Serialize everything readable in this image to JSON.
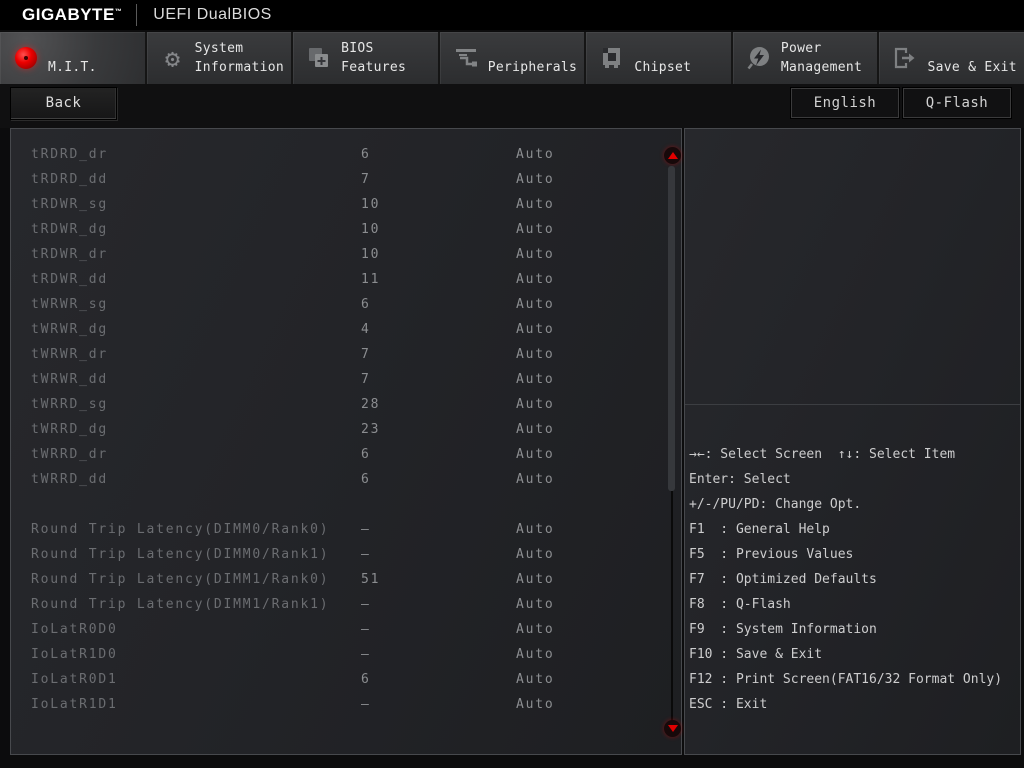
{
  "header": {
    "logo": "GIGABYTE",
    "logo_tm": "™",
    "title": "UEFI DualBIOS"
  },
  "tabs": [
    {
      "label": "M.I.T.",
      "icon": "mit-red-dot",
      "active": true
    },
    {
      "label": "System Information",
      "icon": "gear",
      "active": false
    },
    {
      "label": "BIOS Features",
      "icon": "bios-chip-plus",
      "active": false
    },
    {
      "label": "Peripherals",
      "icon": "peripheral-plug",
      "active": false
    },
    {
      "label": "Chipset",
      "icon": "chipset",
      "active": false
    },
    {
      "label": "Power Management",
      "icon": "power-bolt",
      "active": false
    },
    {
      "label": "Save & Exit",
      "icon": "exit-door",
      "active": false
    }
  ],
  "toolbar": {
    "back": "Back",
    "language": "English",
    "qflash": "Q-Flash"
  },
  "settings": {
    "rows": [
      {
        "name": "tRDRD_dr",
        "value": "6",
        "mode": "Auto"
      },
      {
        "name": "tRDRD_dd",
        "value": "7",
        "mode": "Auto"
      },
      {
        "name": "tRDWR_sg",
        "value": "10",
        "mode": "Auto"
      },
      {
        "name": "tRDWR_dg",
        "value": "10",
        "mode": "Auto"
      },
      {
        "name": "tRDWR_dr",
        "value": "10",
        "mode": "Auto"
      },
      {
        "name": "tRDWR_dd",
        "value": "11",
        "mode": "Auto"
      },
      {
        "name": "tWRWR_sg",
        "value": "6",
        "mode": "Auto"
      },
      {
        "name": "tWRWR_dg",
        "value": "4",
        "mode": "Auto"
      },
      {
        "name": "tWRWR_dr",
        "value": "7",
        "mode": "Auto"
      },
      {
        "name": "tWRWR_dd",
        "value": "7",
        "mode": "Auto"
      },
      {
        "name": "tWRRD_sg",
        "value": "28",
        "mode": "Auto"
      },
      {
        "name": "tWRRD_dg",
        "value": "23",
        "mode": "Auto"
      },
      {
        "name": "tWRRD_dr",
        "value": "6",
        "mode": "Auto"
      },
      {
        "name": "tWRRD_dd",
        "value": "6",
        "mode": "Auto"
      },
      {
        "spacer": true
      },
      {
        "name": "Round Trip Latency(DIMM0/Rank0)",
        "value": "–",
        "mode": "Auto"
      },
      {
        "name": "Round Trip Latency(DIMM0/Rank1)",
        "value": "–",
        "mode": "Auto"
      },
      {
        "name": "Round Trip Latency(DIMM1/Rank0)",
        "value": "51",
        "mode": "Auto"
      },
      {
        "name": "Round Trip Latency(DIMM1/Rank1)",
        "value": "–",
        "mode": "Auto"
      },
      {
        "name": "IoLatR0D0",
        "value": "–",
        "mode": "Auto"
      },
      {
        "name": "IoLatR1D0",
        "value": "–",
        "mode": "Auto"
      },
      {
        "name": "IoLatR0D1",
        "value": "6",
        "mode": "Auto"
      },
      {
        "name": "IoLatR1D1",
        "value": "–",
        "mode": "Auto"
      }
    ]
  },
  "help": {
    "lines": [
      "→←: Select Screen  ↑↓: Select Item",
      "Enter: Select",
      "+/-/PU/PD: Change Opt.",
      "F1  : General Help",
      "F5  : Previous Values",
      "F7  : Optimized Defaults",
      "F8  : Q-Flash",
      "F9  : System Information",
      "F10 : Save & Exit",
      "F12 : Print Screen(FAT16/32 Format Only)",
      "ESC : Exit"
    ]
  },
  "colors": {
    "accent_red": "#e00000",
    "panel_bg": "#232428",
    "panel_border": "#47494d",
    "row_name_text": "#6b6d71",
    "row_value_text": "#8b8d90",
    "help_text": "#cdcdce",
    "tab_text": "#e6e6e6"
  }
}
